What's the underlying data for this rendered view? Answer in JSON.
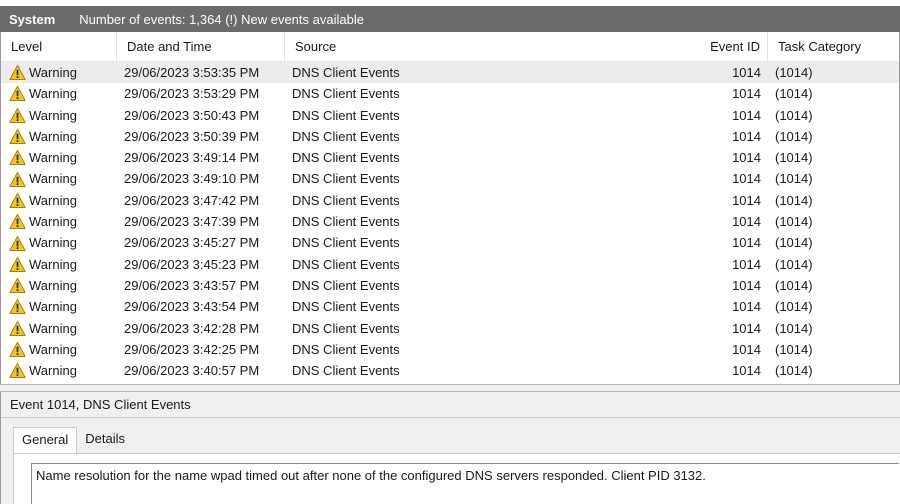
{
  "header": {
    "title": "System",
    "info": "Number of events: 1,364 (!) New events available"
  },
  "columns": {
    "level": "Level",
    "date_time": "Date and Time",
    "source": "Source",
    "event_id": "Event ID",
    "task_category": "Task Category"
  },
  "events": [
    {
      "level": "Warning",
      "date_time": "29/06/2023 3:53:35 PM",
      "source": "DNS Client Events",
      "event_id": "1014",
      "task_category": "(1014)"
    },
    {
      "level": "Warning",
      "date_time": "29/06/2023 3:53:29 PM",
      "source": "DNS Client Events",
      "event_id": "1014",
      "task_category": "(1014)"
    },
    {
      "level": "Warning",
      "date_time": "29/06/2023 3:50:43 PM",
      "source": "DNS Client Events",
      "event_id": "1014",
      "task_category": "(1014)"
    },
    {
      "level": "Warning",
      "date_time": "29/06/2023 3:50:39 PM",
      "source": "DNS Client Events",
      "event_id": "1014",
      "task_category": "(1014)"
    },
    {
      "level": "Warning",
      "date_time": "29/06/2023 3:49:14 PM",
      "source": "DNS Client Events",
      "event_id": "1014",
      "task_category": "(1014)"
    },
    {
      "level": "Warning",
      "date_time": "29/06/2023 3:49:10 PM",
      "source": "DNS Client Events",
      "event_id": "1014",
      "task_category": "(1014)"
    },
    {
      "level": "Warning",
      "date_time": "29/06/2023 3:47:42 PM",
      "source": "DNS Client Events",
      "event_id": "1014",
      "task_category": "(1014)"
    },
    {
      "level": "Warning",
      "date_time": "29/06/2023 3:47:39 PM",
      "source": "DNS Client Events",
      "event_id": "1014",
      "task_category": "(1014)"
    },
    {
      "level": "Warning",
      "date_time": "29/06/2023 3:45:27 PM",
      "source": "DNS Client Events",
      "event_id": "1014",
      "task_category": "(1014)"
    },
    {
      "level": "Warning",
      "date_time": "29/06/2023 3:45:23 PM",
      "source": "DNS Client Events",
      "event_id": "1014",
      "task_category": "(1014)"
    },
    {
      "level": "Warning",
      "date_time": "29/06/2023 3:43:57 PM",
      "source": "DNS Client Events",
      "event_id": "1014",
      "task_category": "(1014)"
    },
    {
      "level": "Warning",
      "date_time": "29/06/2023 3:43:54 PM",
      "source": "DNS Client Events",
      "event_id": "1014",
      "task_category": "(1014)"
    },
    {
      "level": "Warning",
      "date_time": "29/06/2023 3:42:28 PM",
      "source": "DNS Client Events",
      "event_id": "1014",
      "task_category": "(1014)"
    },
    {
      "level": "Warning",
      "date_time": "29/06/2023 3:42:25 PM",
      "source": "DNS Client Events",
      "event_id": "1014",
      "task_category": "(1014)"
    },
    {
      "level": "Warning",
      "date_time": "29/06/2023 3:40:57 PM",
      "source": "DNS Client Events",
      "event_id": "1014",
      "task_category": "(1014)"
    }
  ],
  "selected_index": 0,
  "level_icon": "warning-triangle-icon",
  "colors": {
    "header_bg": "#6b6b6b",
    "selected_row": "#ececec",
    "warning_fill": "#f5c518"
  },
  "detail": {
    "title": "Event 1014, DNS Client Events",
    "tabs": [
      {
        "label": "General",
        "active": true
      },
      {
        "label": "Details",
        "active": false
      }
    ],
    "message": "Name resolution for the name wpad timed out after none of the configured DNS servers responded. Client PID 3132."
  }
}
